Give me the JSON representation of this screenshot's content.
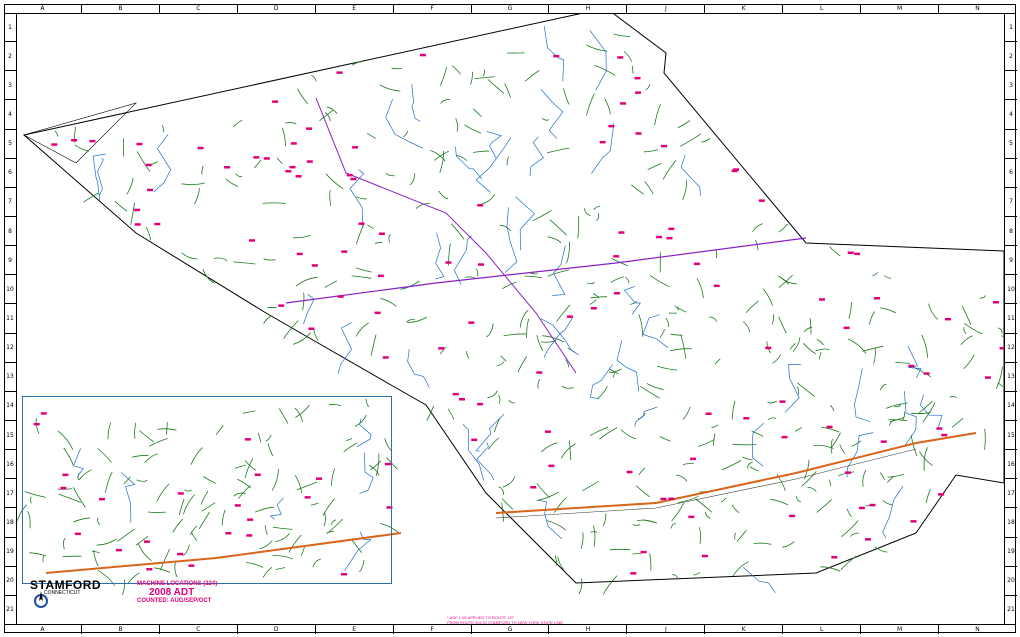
{
  "sheet": {
    "columns": [
      "A",
      "B",
      "C",
      "D",
      "E",
      "F",
      "G",
      "H",
      "J",
      "K",
      "L",
      "M",
      "N"
    ],
    "rows": [
      "1",
      "2",
      "3",
      "4",
      "5",
      "6",
      "7",
      "8",
      "9",
      "10",
      "11",
      "12",
      "13",
      "14",
      "15",
      "16",
      "17",
      "18",
      "19",
      "20",
      "21"
    ]
  },
  "legend": {
    "city": "STAMFORD",
    "state": "CONNECTICUT",
    "machine_locations": "MACHINE LOCATIONS (224)",
    "adt_year": "2008 ADT",
    "counted": "COUNTED: AUG/SEP/OCT",
    "north_label": "N"
  },
  "notes": {
    "line1": "* AGF 1.05 APPLIED TO ROUTE 137",
    "line2": "FROM ROUTE 104 IO STAMFORD TO NEW YORK STATE LINE"
  },
  "colors": {
    "roads": "#1e7a1e",
    "water": "#1f6fd0",
    "counts": "#e2007a",
    "highway": "#8a1fc4",
    "interstate": "#d9641a",
    "boundary": "#000000"
  }
}
